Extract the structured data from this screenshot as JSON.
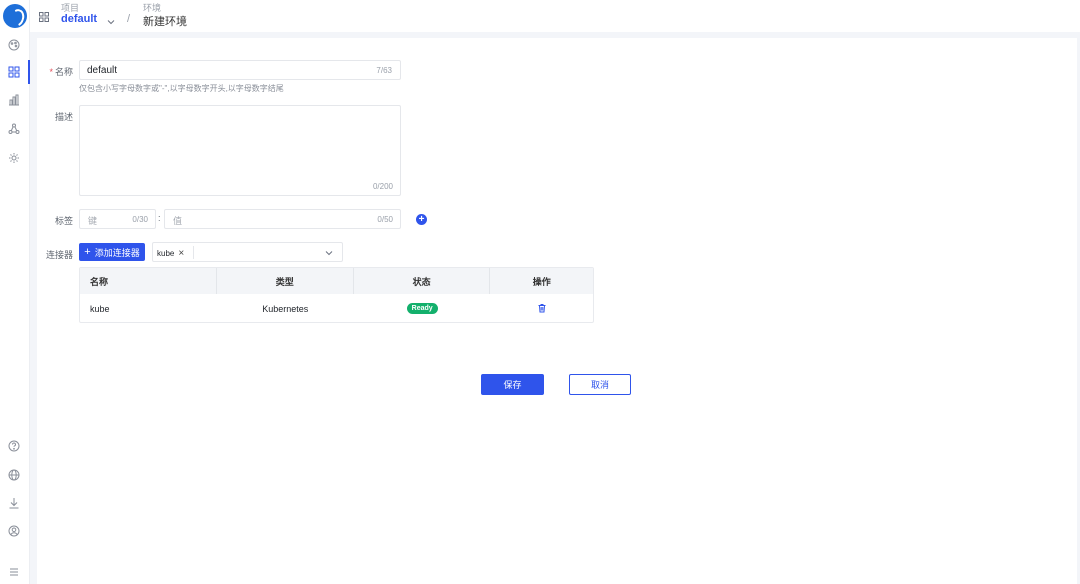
{
  "sidebar": {
    "items": [
      {
        "icon": "palette-icon"
      },
      {
        "icon": "grid-icon",
        "active": true
      },
      {
        "icon": "bar-chart-icon"
      },
      {
        "icon": "share-triangle-icon"
      },
      {
        "icon": "gear-icon"
      }
    ],
    "bottom_items": [
      {
        "icon": "help-icon"
      },
      {
        "icon": "globe-icon"
      },
      {
        "icon": "download-icon"
      },
      {
        "icon": "user-circle-icon"
      },
      {
        "icon": "menu-icon"
      }
    ]
  },
  "breadcrumb": {
    "project_label": "项目",
    "project_value": "default",
    "separator": "/",
    "env_label": "环境",
    "env_value": "新建环境"
  },
  "form": {
    "name": {
      "label": "名称",
      "required_mark": "*",
      "value": "default",
      "counter": "7/63",
      "hint": "仅包含小写字母数字或\"-\",以字母数字开头,以字母数字结尾"
    },
    "description": {
      "label": "描述",
      "value": "",
      "counter": "0/200"
    },
    "tags": {
      "label": "标签",
      "key_placeholder": "键",
      "key_counter": "0/30",
      "colon": ":",
      "value_placeholder": "值",
      "value_counter": "0/50",
      "add_symbol": "+"
    },
    "connector": {
      "label": "连接器",
      "add_button_label": "添加连接器",
      "add_button_symbol": "+",
      "selected_tag": "kube",
      "tag_close": "×"
    }
  },
  "table": {
    "columns": [
      "名称",
      "类型",
      "状态",
      "操作"
    ],
    "rows": [
      {
        "name": "kube",
        "type": "Kubernetes",
        "status": "Ready"
      }
    ]
  },
  "actions": {
    "save_label": "保存",
    "cancel_label": "取消"
  },
  "colors": {
    "primary": "#2f54eb",
    "ready": "#13b06c",
    "required": "#e34d59"
  }
}
